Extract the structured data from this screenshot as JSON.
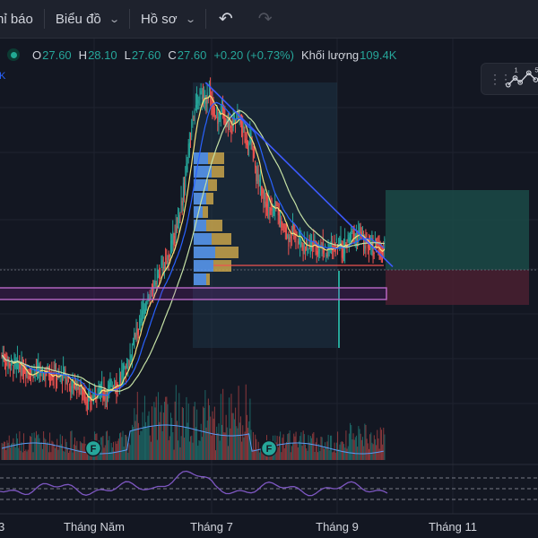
{
  "toolbar": {
    "items": [
      {
        "label": "hỉ báo"
      },
      {
        "label": "Biểu đồ"
      },
      {
        "label": "Hồ sơ"
      }
    ]
  },
  "legend": {
    "o_key": "O",
    "o_val": "27.60",
    "h_key": "H",
    "h_val": "28.10",
    "l_key": "L",
    "l_val": "27.60",
    "c_key": "C",
    "c_val": "27.60",
    "change": "+0.20 (+0.73%)",
    "volume_key": "Khối lượng",
    "volume_val": "109.4K"
  },
  "corner_mark": "K",
  "widget": {
    "label_a": "1",
    "label_b": "5"
  },
  "markers": [
    {
      "text": "F"
    },
    {
      "text": "F"
    }
  ],
  "colors": {
    "background": "#131722",
    "up": "#26a69a",
    "down": "#ef5350",
    "trendline": "#2962ff",
    "support_box": "#9c27b0",
    "rsi": "#7e57c2"
  },
  "chart_data": {
    "type": "candlestick",
    "x_tick_labels": [
      "3",
      "Tháng Năm",
      "Tháng 7",
      "Tháng 9",
      "Tháng 11"
    ],
    "last": {
      "open": 27.6,
      "high": 28.1,
      "low": 27.6,
      "close": 27.6,
      "change": 0.2,
      "change_pct": 0.73,
      "volume": "109.4K"
    },
    "price_path": [
      22,
      21.8,
      21.6,
      21.4,
      21.5,
      21.2,
      21.3,
      21.0,
      21.2,
      21.1,
      20.9,
      21.2,
      21.0,
      21.1,
      20.8,
      21.0,
      20.6,
      20.4,
      20.5,
      20.3,
      19.9,
      19.6,
      19.8,
      20.1,
      20.3,
      20.0,
      20.3,
      20.6,
      20.4,
      21.0,
      21.3,
      21.9,
      22.8,
      23.3,
      24.1,
      24.6,
      25.1,
      25.7,
      26.1,
      26.6,
      26.9,
      27.6,
      28.4,
      29.4,
      30.6,
      32.3,
      34.1,
      34.6,
      35.1,
      34.8,
      35.4,
      34.3,
      33.9,
      34.6,
      33.8,
      33.6,
      33.9,
      34.3,
      33.4,
      32.6,
      32.9,
      31.4,
      30.6,
      30.1,
      29.6,
      29.1,
      29.6,
      28.8,
      28.3,
      27.9,
      28.4,
      27.8,
      27.4,
      27.6,
      27.3,
      27.7,
      27.3,
      27.6,
      27.1,
      27.4,
      27.5,
      27.8,
      27.2,
      27.6,
      28.1,
      27.9,
      28.2,
      27.6,
      27.8,
      27.3,
      27.5,
      27.3,
      27.6
    ],
    "resistance_line": {
      "from": [
        48,
        35.8
      ],
      "to": [
        92,
        27.0
      ]
    },
    "support_zone": {
      "low": 26.5,
      "high": 26.9
    },
    "position": {
      "entry": 27.6,
      "target": 31.6,
      "stop": 26.4
    }
  }
}
